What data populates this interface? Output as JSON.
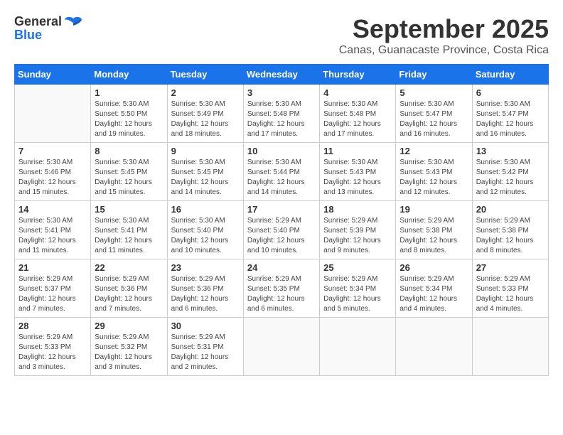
{
  "header": {
    "logo_general": "General",
    "logo_blue": "Blue",
    "month": "September 2025",
    "location": "Canas, Guanacaste Province, Costa Rica"
  },
  "weekdays": [
    "Sunday",
    "Monday",
    "Tuesday",
    "Wednesday",
    "Thursday",
    "Friday",
    "Saturday"
  ],
  "weeks": [
    [
      {
        "day": "",
        "info": ""
      },
      {
        "day": "1",
        "info": "Sunrise: 5:30 AM\nSunset: 5:50 PM\nDaylight: 12 hours\nand 19 minutes."
      },
      {
        "day": "2",
        "info": "Sunrise: 5:30 AM\nSunset: 5:49 PM\nDaylight: 12 hours\nand 18 minutes."
      },
      {
        "day": "3",
        "info": "Sunrise: 5:30 AM\nSunset: 5:48 PM\nDaylight: 12 hours\nand 17 minutes."
      },
      {
        "day": "4",
        "info": "Sunrise: 5:30 AM\nSunset: 5:48 PM\nDaylight: 12 hours\nand 17 minutes."
      },
      {
        "day": "5",
        "info": "Sunrise: 5:30 AM\nSunset: 5:47 PM\nDaylight: 12 hours\nand 16 minutes."
      },
      {
        "day": "6",
        "info": "Sunrise: 5:30 AM\nSunset: 5:47 PM\nDaylight: 12 hours\nand 16 minutes."
      }
    ],
    [
      {
        "day": "7",
        "info": "Sunrise: 5:30 AM\nSunset: 5:46 PM\nDaylight: 12 hours\nand 15 minutes."
      },
      {
        "day": "8",
        "info": "Sunrise: 5:30 AM\nSunset: 5:45 PM\nDaylight: 12 hours\nand 15 minutes."
      },
      {
        "day": "9",
        "info": "Sunrise: 5:30 AM\nSunset: 5:45 PM\nDaylight: 12 hours\nand 14 minutes."
      },
      {
        "day": "10",
        "info": "Sunrise: 5:30 AM\nSunset: 5:44 PM\nDaylight: 12 hours\nand 14 minutes."
      },
      {
        "day": "11",
        "info": "Sunrise: 5:30 AM\nSunset: 5:43 PM\nDaylight: 12 hours\nand 13 minutes."
      },
      {
        "day": "12",
        "info": "Sunrise: 5:30 AM\nSunset: 5:43 PM\nDaylight: 12 hours\nand 12 minutes."
      },
      {
        "day": "13",
        "info": "Sunrise: 5:30 AM\nSunset: 5:42 PM\nDaylight: 12 hours\nand 12 minutes."
      }
    ],
    [
      {
        "day": "14",
        "info": "Sunrise: 5:30 AM\nSunset: 5:41 PM\nDaylight: 12 hours\nand 11 minutes."
      },
      {
        "day": "15",
        "info": "Sunrise: 5:30 AM\nSunset: 5:41 PM\nDaylight: 12 hours\nand 11 minutes."
      },
      {
        "day": "16",
        "info": "Sunrise: 5:30 AM\nSunset: 5:40 PM\nDaylight: 12 hours\nand 10 minutes."
      },
      {
        "day": "17",
        "info": "Sunrise: 5:29 AM\nSunset: 5:40 PM\nDaylight: 12 hours\nand 10 minutes."
      },
      {
        "day": "18",
        "info": "Sunrise: 5:29 AM\nSunset: 5:39 PM\nDaylight: 12 hours\nand 9 minutes."
      },
      {
        "day": "19",
        "info": "Sunrise: 5:29 AM\nSunset: 5:38 PM\nDaylight: 12 hours\nand 8 minutes."
      },
      {
        "day": "20",
        "info": "Sunrise: 5:29 AM\nSunset: 5:38 PM\nDaylight: 12 hours\nand 8 minutes."
      }
    ],
    [
      {
        "day": "21",
        "info": "Sunrise: 5:29 AM\nSunset: 5:37 PM\nDaylight: 12 hours\nand 7 minutes."
      },
      {
        "day": "22",
        "info": "Sunrise: 5:29 AM\nSunset: 5:36 PM\nDaylight: 12 hours\nand 7 minutes."
      },
      {
        "day": "23",
        "info": "Sunrise: 5:29 AM\nSunset: 5:36 PM\nDaylight: 12 hours\nand 6 minutes."
      },
      {
        "day": "24",
        "info": "Sunrise: 5:29 AM\nSunset: 5:35 PM\nDaylight: 12 hours\nand 6 minutes."
      },
      {
        "day": "25",
        "info": "Sunrise: 5:29 AM\nSunset: 5:34 PM\nDaylight: 12 hours\nand 5 minutes."
      },
      {
        "day": "26",
        "info": "Sunrise: 5:29 AM\nSunset: 5:34 PM\nDaylight: 12 hours\nand 4 minutes."
      },
      {
        "day": "27",
        "info": "Sunrise: 5:29 AM\nSunset: 5:33 PM\nDaylight: 12 hours\nand 4 minutes."
      }
    ],
    [
      {
        "day": "28",
        "info": "Sunrise: 5:29 AM\nSunset: 5:33 PM\nDaylight: 12 hours\nand 3 minutes."
      },
      {
        "day": "29",
        "info": "Sunrise: 5:29 AM\nSunset: 5:32 PM\nDaylight: 12 hours\nand 3 minutes."
      },
      {
        "day": "30",
        "info": "Sunrise: 5:29 AM\nSunset: 5:31 PM\nDaylight: 12 hours\nand 2 minutes."
      },
      {
        "day": "",
        "info": ""
      },
      {
        "day": "",
        "info": ""
      },
      {
        "day": "",
        "info": ""
      },
      {
        "day": "",
        "info": ""
      }
    ]
  ]
}
